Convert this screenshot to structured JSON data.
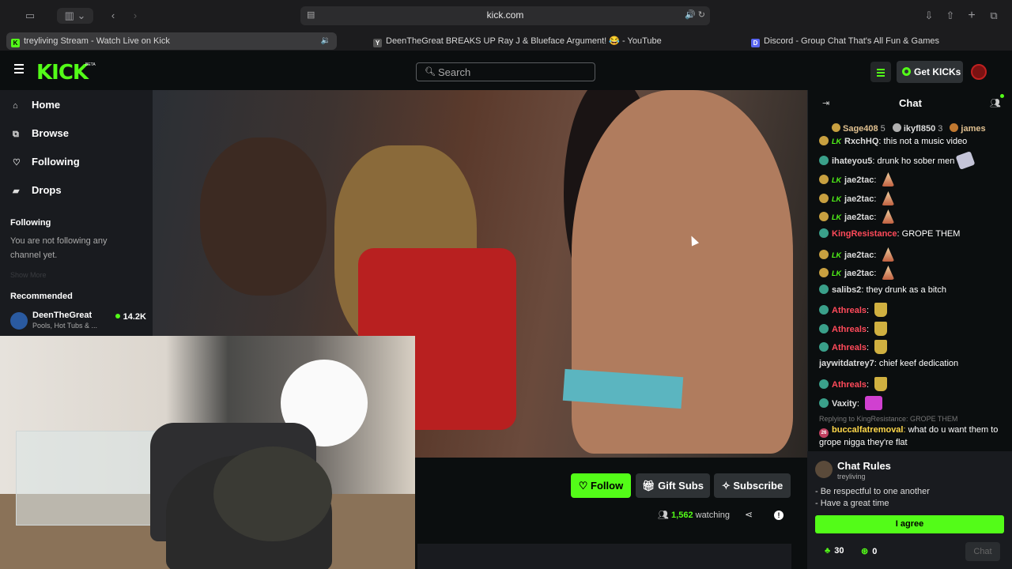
{
  "browser": {
    "url": "kick.com",
    "tabs": [
      {
        "title": "treyliving Stream - Watch Live on Kick",
        "fav_color": "#53fc18",
        "fav_letter": "K",
        "active": true
      },
      {
        "title": "DeenTheGreat BREAKS UP Ray J & Blueface Argument! 😂 - YouTube",
        "fav_color": "#555555",
        "fav_letter": "Y",
        "active": false
      },
      {
        "title": "Discord - Group Chat That's All Fun & Games",
        "fav_color": "#5865f2",
        "fav_letter": "D",
        "active": false
      }
    ]
  },
  "header": {
    "logo": "KICK",
    "logo_badge": "BETA",
    "search_placeholder": "Search",
    "get_kicks_label": "Get KICKs"
  },
  "sidebar": {
    "nav": [
      {
        "label": "Home",
        "icon": "home-icon"
      },
      {
        "label": "Browse",
        "icon": "browse-icon"
      },
      {
        "label": "Following",
        "icon": "heart-icon"
      },
      {
        "label": "Drops",
        "icon": "drops-icon"
      }
    ],
    "following_heading": "Following",
    "following_empty": "You are not following any channel yet.",
    "show_more": "Show More",
    "recommended_heading": "Recommended",
    "recommended": [
      {
        "name": "DeenTheGreat",
        "category": "Pools, Hot Tubs & ...",
        "viewers": "14.2K"
      }
    ]
  },
  "stream": {
    "follow_label": "Follow",
    "gift_label": "Gift Subs",
    "subscribe_label": "Subscribe",
    "viewers": "1,562",
    "watching_label": "watching"
  },
  "chat": {
    "title": "Chat",
    "top_gifters": [
      {
        "name": "Sage408",
        "count": "5",
        "color": "#e0c090",
        "badge": "#c8a040"
      },
      {
        "name": "ikyfl850",
        "count": "3",
        "color": "#dddddd",
        "badge": "#b0b0b0"
      },
      {
        "name": "james",
        "count": "",
        "color": "#e0c090",
        "badge": "#c07830"
      }
    ],
    "messages": [
      {
        "user": "RxchHQ",
        "color": "#dddddd",
        "text": "this not a music video",
        "badges": [
          "gold",
          "lk"
        ],
        "emote": ""
      },
      {
        "user": "ihateyou5",
        "color": "#dddddd",
        "text": "drunk ho sober men",
        "badges": [
          "sub"
        ],
        "emote": "sticker"
      },
      {
        "user": "jae2tac",
        "color": "#dddddd",
        "text": "",
        "badges": [
          "gold",
          "lk"
        ],
        "emote": "star"
      },
      {
        "user": "jae2tac",
        "color": "#dddddd",
        "text": "",
        "badges": [
          "gold",
          "lk"
        ],
        "emote": "star"
      },
      {
        "user": "jae2tac",
        "color": "#dddddd",
        "text": "",
        "badges": [
          "gold",
          "lk"
        ],
        "emote": "star"
      },
      {
        "user": "KingResistance",
        "color": "#ff4a5a",
        "text": "GROPE THEM",
        "badges": [
          "sub"
        ],
        "emote": ""
      },
      {
        "user": "jae2tac",
        "color": "#dddddd",
        "text": "",
        "badges": [
          "gold",
          "lk"
        ],
        "emote": "star"
      },
      {
        "user": "jae2tac",
        "color": "#dddddd",
        "text": "",
        "badges": [
          "gold",
          "lk"
        ],
        "emote": "star"
      },
      {
        "user": "salibs2",
        "color": "#dddddd",
        "text": "they drunk as a bitch",
        "badges": [
          "sub"
        ],
        "emote": ""
      },
      {
        "user": "Athreals",
        "color": "#ff4a5a",
        "text": "",
        "badges": [
          "sub"
        ],
        "emote": "trophy"
      },
      {
        "user": "Athreals",
        "color": "#ff4a5a",
        "text": "",
        "badges": [
          "sub"
        ],
        "emote": "trophy"
      },
      {
        "user": "Athreals",
        "color": "#ff4a5a",
        "text": "",
        "badges": [
          "sub"
        ],
        "emote": "trophy"
      },
      {
        "user": "jaywitdatrey7",
        "color": "#dddddd",
        "text": "chief keef dedication",
        "badges": [],
        "emote": ""
      },
      {
        "user": "Athreals",
        "color": "#ff4a5a",
        "text": "",
        "badges": [
          "sub"
        ],
        "emote": "trophy"
      },
      {
        "user": "Vaxity",
        "color": "#dddddd",
        "text": "",
        "badges": [
          "sub"
        ],
        "emote": "crown"
      }
    ],
    "reply_ref": "Replying to KingResistance: GROPE THEM",
    "reply": {
      "user": "buccalfatremoval",
      "color": "#ffd84a",
      "text": "what do u want them to grope nigga they're flat"
    },
    "rules_title": "Chat Rules",
    "rules_by": "treyliving",
    "rules": [
      "- Be respectful to one another",
      "- Have a great time"
    ],
    "agree_label": "I agree",
    "kicks_count": "30",
    "points_count": "0",
    "send_label": "Chat"
  },
  "colors": {
    "accent": "#53fc18",
    "background": "#0b0e0f",
    "panel": "#191b1f"
  }
}
